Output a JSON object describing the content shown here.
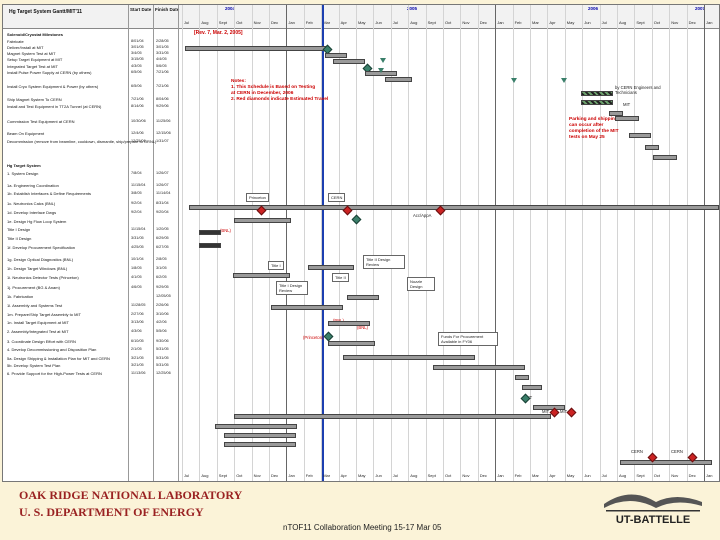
{
  "header": {
    "title": "Hg Target System Gantt/MIT'11",
    "col_start": "Start Date",
    "col_finish": "Finish Date",
    "years": [
      "2004",
      "2005",
      "2006",
      "2007"
    ],
    "months": [
      "Jul",
      "Aug",
      "Sept",
      "Oct",
      "Nov",
      "Dec",
      "Jan",
      "Feb",
      "Mar",
      "Apr",
      "May",
      "Jun",
      "Jul",
      "Aug",
      "Sept",
      "Oct",
      "Nov",
      "Dec",
      "Jan",
      "Feb",
      "Mar",
      "Apr",
      "May",
      "Jun",
      "Jul",
      "Aug",
      "Sept",
      "Oct",
      "Nov",
      "Dec",
      "Jan"
    ]
  },
  "revision": "[Rev. 7, Mar. 2, 2005]",
  "rows": [
    {
      "name": "Solenoid/Cryostat Milestones",
      "start": "",
      "finish": "",
      "bold": true
    },
    {
      "name": "Fabricate",
      "start": "8/01/04",
      "finish": "2/28/05"
    },
    {
      "name": "Deliver/Install at MIT",
      "start": "3/01/05",
      "finish": "3/01/05"
    },
    {
      "name": "Magnet System Test at MIT",
      "start": "3/4/05",
      "finish": "3/31/05"
    },
    {
      "name": "Setup Target Equipment at MIT",
      "start": "3/15/05",
      "finish": "4/4/05"
    },
    {
      "name": "Integrated Target Test at MIT",
      "start": "4/3/05",
      "finish": "5/6/05"
    },
    {
      "name": "Install Pulse Power Supply at CERN (by others)",
      "start": "6/5/06",
      "finish": "7/21/06"
    },
    {
      "name": "Install Cryo System Equipment & Power (by others)",
      "start": "6/5/06",
      "finish": "7/21/06"
    },
    {
      "name": "Ship Magnet System To CERN",
      "start": "7/21/06",
      "finish": "8/04/06"
    },
    {
      "name": "Install and Test Equipment in TT2A Tunnel (at CERN)",
      "start": "8/14/06",
      "finish": "9/29/06"
    },
    {
      "name": "Commission Test Equipment at CERN",
      "start": "10/30/06",
      "finish": "11/25/06"
    },
    {
      "name": "Beam On Equipment",
      "start": "12/4/06",
      "finish": "12/15/06"
    },
    {
      "name": "Decommission (remove from beamline, cooldown, dismantle, ship/prepare to ORNL)",
      "start": "12/25/06",
      "finish": "1/31/07"
    },
    {
      "name": "Hg Target System",
      "start": "",
      "finish": "",
      "bold": true
    },
    {
      "name": "1. System Design",
      "start": "7/8/04",
      "finish": "1/26/07"
    },
    {
      "name": "1a. Engineering Coordination",
      "start": "11/15/04",
      "finish": "1/26/07"
    },
    {
      "name": "1b. Establish Interfaces & Define Requirements",
      "start": "3/8/05",
      "finish": "11/14/04"
    },
    {
      "name": "1c. Neutronics Calcs (BNL)",
      "start": "9/2/04",
      "finish": "8/31/04"
    },
    {
      "name": "1d. Develop Interface Dwgs",
      "start": "9/2/04",
      "finish": "9/20/04"
    },
    {
      "name": "1e. Design Hg Flow Loop System",
      "start": "",
      "finish": ""
    },
    {
      "name": "Title I Design",
      "start": "11/15/04",
      "finish": "1/20/05"
    },
    {
      "name": "Title II Design",
      "start": "3/31/05",
      "finish": "6/29/05"
    },
    {
      "name": "1f. Develop Procurement Specification",
      "start": "4/25/05",
      "finish": "6/27/05"
    },
    {
      "name": "1g. Design Optical Diagnostics (BNL)",
      "start": "10/1/04",
      "finish": "2/8/05"
    },
    {
      "name": "1h. Design Target Windows (BNL)",
      "start": "1/8/05",
      "finish": "3/1/05"
    },
    {
      "name": "1i. Neutronics Detector Tests (Princeton)",
      "start": "4/1/05",
      "finish": "6/2/05"
    },
    {
      "name": "1j. Procurement (BG & Anam)",
      "start": "4/6/05",
      "finish": "9/29/05"
    },
    {
      "name": "1k. Fabrication",
      "start": "",
      "finish": "12/05/05"
    },
    {
      "name": "1l. Assembly and Systems Test",
      "start": "11/28/05",
      "finish": "2/26/06"
    },
    {
      "name": "1m. Prepare/Ship Target Assembly to MIT",
      "start": "2/27/06",
      "finish": "3/10/06"
    },
    {
      "name": "1n. Install Target Equipment at MIT",
      "start": "3/13/06",
      "finish": "4/2/06"
    },
    {
      "name": "2. Assembly/Integrated Test at MIT",
      "start": "4/3/06",
      "finish": "5/5/06"
    },
    {
      "name": "3. Coordinate Design Effort with CERN",
      "start": "6/10/05",
      "finish": "9/30/06"
    },
    {
      "name": "4. Develop Decommissioning and Disposition Plan",
      "start": "2/1/05",
      "finish": "5/31/05"
    },
    {
      "name": "5a. Design Shipping & Installation Plan for MIT and CERN",
      "start": "3/21/05",
      "finish": "5/31/05"
    },
    {
      "name": "5b. Develop System Test Plan",
      "start": "3/21/05",
      "finish": "5/31/05"
    },
    {
      "name": "6. Provide Support for the High-Power Tests at CERN",
      "start": "11/13/06",
      "finish": "12/25/06"
    }
  ],
  "notes": {
    "red_note": [
      "Notes:",
      "1. This Schedule is Based on Testing",
      "at CERN in December, 2006",
      "2. Red diamonds indicate Estimated Travel"
    ],
    "parking_note": [
      "Parking and shipping",
      "can occur after",
      "completion of the MIT",
      "tests on May 25"
    ],
    "cern_engineers": "by CERN Engineers and Technicians",
    "mit_label": "MIT"
  },
  "labels": {
    "princeton": "Princeton",
    "cern": "CERN",
    "acc_appa": "Acc/AppA",
    "bnl_paren": "(BNL)",
    "title1": "Title I",
    "title2": "Title II",
    "title2_review": "Title II Design Review",
    "title1_review": "Title I Design Review",
    "nozzle": "Nozzle Design",
    "bnl1": "(BNL)",
    "bnl2": "(BNL)",
    "princeton2": "(Princeton)",
    "funds": "Funds For Procurement Available in FY06",
    "mit_a": "MIT",
    "mit_b": "MIT",
    "mit_c": "MIT",
    "cern_b": "CERN",
    "cern_c": "CERN"
  },
  "footer": {
    "org1": "OAK RIDGE NATIONAL LABORATORY",
    "org2": "U. S. DEPARTMENT OF ENERGY",
    "meeting": "nTOF11 Collaboration Meeting 15-17 Mar 05",
    "logo": "UT-BATTELLE"
  },
  "colors": {
    "today_line": "#1c3fb0",
    "milestone": "#3a7f6a",
    "travel": "#cc2222",
    "note": "#cc0000"
  }
}
